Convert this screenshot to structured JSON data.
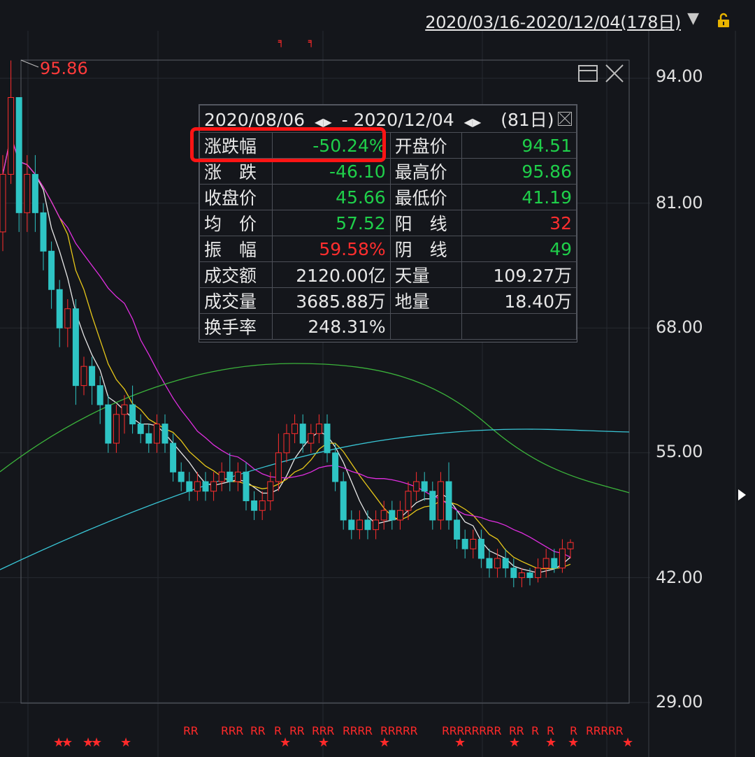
{
  "header": {
    "date_range": "2020/03/16-2020/12/04(178日)",
    "dropdown_icon": "triangle-down-icon",
    "lock_icon": "lock-icon"
  },
  "price_axis": [
    "94.00",
    "81.00",
    "68.00",
    "55.00",
    "42.00",
    "29.00"
  ],
  "max_marker": "95.86",
  "stats_panel": {
    "start_date": "2020/08/06",
    "end_date": "2020/12/04",
    "days": "(81日)",
    "separator": "-",
    "rows": [
      {
        "l1": "涨跌幅",
        "v1": "-50.24%",
        "c1": "green",
        "l2": "开盘价",
        "v2": "94.51",
        "c2": "green"
      },
      {
        "l1": "涨　跌",
        "v1": "-46.10",
        "c1": "green",
        "l2": "最高价",
        "v2": "95.86",
        "c2": "green"
      },
      {
        "l1": "收盘价",
        "v1": "45.66",
        "c1": "green",
        "l2": "最低价",
        "v2": "41.19",
        "c2": "green"
      },
      {
        "l1": "均　价",
        "v1": "57.52",
        "c1": "green",
        "l2": "阳　线",
        "v2": "32",
        "c2": "red"
      },
      {
        "l1": "振　幅",
        "v1": "59.58%",
        "c1": "red",
        "l2": "阴　线",
        "v2": "49",
        "c2": "green"
      },
      {
        "l1": "成交额",
        "v1": "2120.00亿",
        "c1": "white",
        "l2": "天量",
        "v2": "109.27万",
        "c2": "white"
      },
      {
        "l1": "成交量",
        "v1": "3685.88万",
        "c1": "white",
        "l2": "地量",
        "v2": "18.40万",
        "c2": "white"
      },
      {
        "l1": "换手率",
        "v1": "248.31%",
        "c1": "white",
        "l2": "",
        "v2": "",
        "c2": "white"
      }
    ]
  },
  "bottom_marks": {
    "r_groups": [
      "RR",
      "RRR",
      "RR",
      "R",
      "RR",
      "RRR",
      "RRRR",
      "RRRRR",
      "RRRRRRRR",
      "RR",
      "R",
      "R",
      "R",
      "RRRRR"
    ],
    "star": "★"
  },
  "colors": {
    "up": "#ff2e2e",
    "down": "#2ec4c4",
    "ma5": "#e8e8e8",
    "ma10": "#e6c619",
    "ma20": "#e02ee0",
    "ma60": "#3bb33b",
    "ma120": "#39c6d6",
    "highlight": "#ff1414"
  },
  "chart_data": {
    "type": "candlestick",
    "ylim": [
      29,
      94
    ],
    "y_ticks": [
      94,
      81,
      68,
      55,
      42,
      29
    ],
    "candles": [
      [
        78,
        84,
        76,
        86
      ],
      [
        84,
        92,
        83,
        95.86
      ],
      [
        92,
        80,
        78,
        92
      ],
      [
        80,
        84,
        78,
        86
      ],
      [
        84,
        80,
        78,
        86
      ],
      [
        80,
        76,
        74,
        81
      ],
      [
        76,
        72,
        70,
        77
      ],
      [
        72,
        68,
        66,
        73
      ],
      [
        68,
        70,
        66,
        71
      ],
      [
        70,
        62,
        60,
        71
      ],
      [
        62,
        64,
        61,
        65
      ],
      [
        64,
        62,
        60,
        65
      ],
      [
        62,
        60,
        58,
        63
      ],
      [
        60,
        56,
        55,
        61
      ],
      [
        56,
        59,
        55,
        60
      ],
      [
        59,
        60,
        57,
        61
      ],
      [
        60,
        58,
        57,
        62
      ],
      [
        58,
        57,
        56,
        59
      ],
      [
        57,
        56,
        55,
        58
      ],
      [
        56,
        58,
        55,
        59
      ],
      [
        58,
        56,
        55,
        59
      ],
      [
        56,
        53,
        52,
        57
      ],
      [
        53,
        52,
        51,
        54
      ],
      [
        52,
        51,
        50,
        53
      ],
      [
        51,
        52,
        50,
        53
      ],
      [
        52,
        51,
        50,
        53
      ],
      [
        51,
        52,
        50,
        53
      ],
      [
        52,
        53,
        51,
        54
      ],
      [
        53,
        52,
        51,
        55
      ],
      [
        52,
        53,
        51,
        54
      ],
      [
        53,
        50,
        49,
        54
      ],
      [
        50,
        49,
        48,
        51
      ],
      [
        49,
        50,
        48,
        51
      ],
      [
        50,
        52,
        49,
        53
      ],
      [
        52,
        55,
        51,
        57
      ],
      [
        55,
        57,
        54,
        58
      ],
      [
        57,
        58,
        56,
        59
      ],
      [
        58,
        56,
        55,
        59
      ],
      [
        56,
        57,
        55,
        58
      ],
      [
        57,
        58,
        56,
        59
      ],
      [
        58,
        55,
        54,
        59
      ],
      [
        55,
        52,
        51,
        56
      ],
      [
        52,
        48,
        47,
        53
      ],
      [
        48,
        47,
        46,
        49
      ],
      [
        47,
        48,
        46,
        49
      ],
      [
        48,
        47,
        46,
        49
      ],
      [
        47,
        48,
        46,
        49
      ],
      [
        48,
        49,
        47,
        50
      ],
      [
        49,
        48,
        47,
        50
      ],
      [
        48,
        49,
        47,
        50
      ],
      [
        49,
        51,
        48,
        52
      ],
      [
        51,
        52,
        50,
        53
      ],
      [
        52,
        51,
        50,
        53
      ],
      [
        51,
        48,
        47,
        52
      ],
      [
        48,
        52,
        47,
        53
      ],
      [
        52,
        48,
        47,
        54
      ],
      [
        48,
        46,
        45,
        49
      ],
      [
        46,
        45,
        44,
        47
      ],
      [
        45,
        46,
        44,
        47
      ],
      [
        46,
        44,
        43,
        47
      ],
      [
        44,
        43,
        42,
        45
      ],
      [
        43,
        44,
        42,
        45
      ],
      [
        44,
        43,
        42,
        45
      ],
      [
        43,
        42,
        41,
        44
      ],
      [
        42,
        42.5,
        41,
        43
      ],
      [
        42.5,
        42,
        41.19,
        43
      ],
      [
        42,
        43,
        41.5,
        44
      ],
      [
        43,
        44,
        42,
        45
      ],
      [
        44,
        43,
        42.5,
        45
      ],
      [
        43,
        45,
        42.5,
        46
      ],
      [
        45,
        45.66,
        44,
        46
      ]
    ]
  }
}
